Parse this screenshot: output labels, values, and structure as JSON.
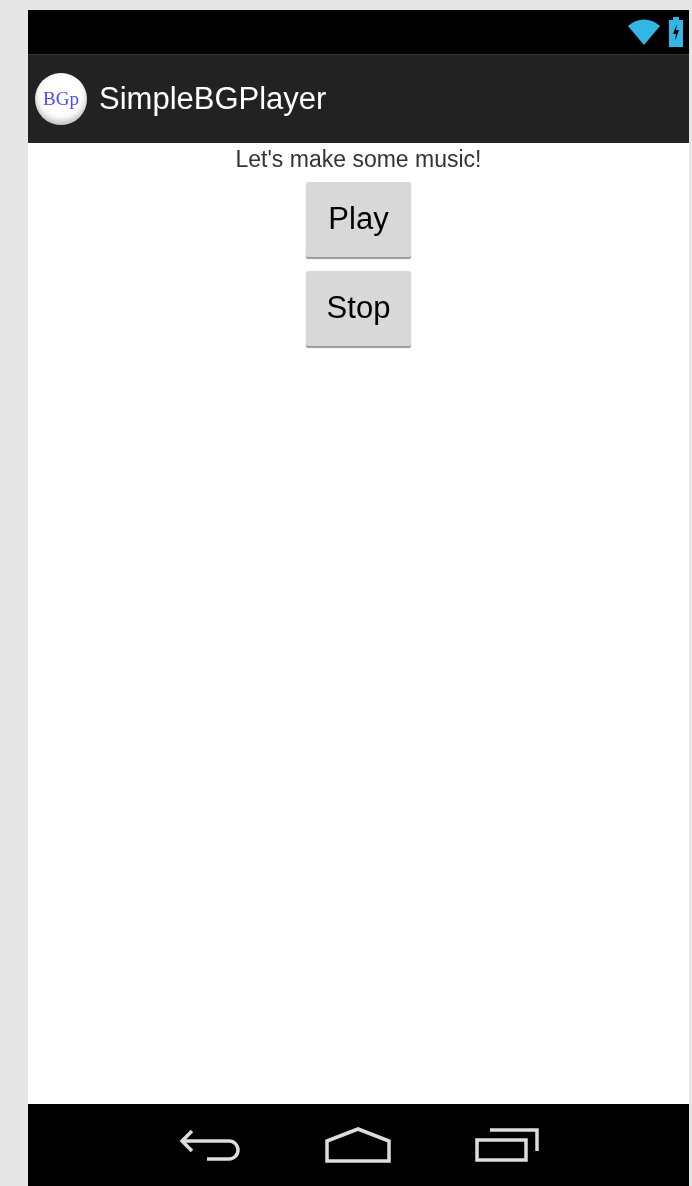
{
  "app_bar": {
    "logo_text": "BGp",
    "title": "SimpleBGPlayer"
  },
  "content": {
    "message": "Let's make some music!",
    "buttons": [
      {
        "label": "Play"
      },
      {
        "label": "Stop"
      }
    ]
  }
}
